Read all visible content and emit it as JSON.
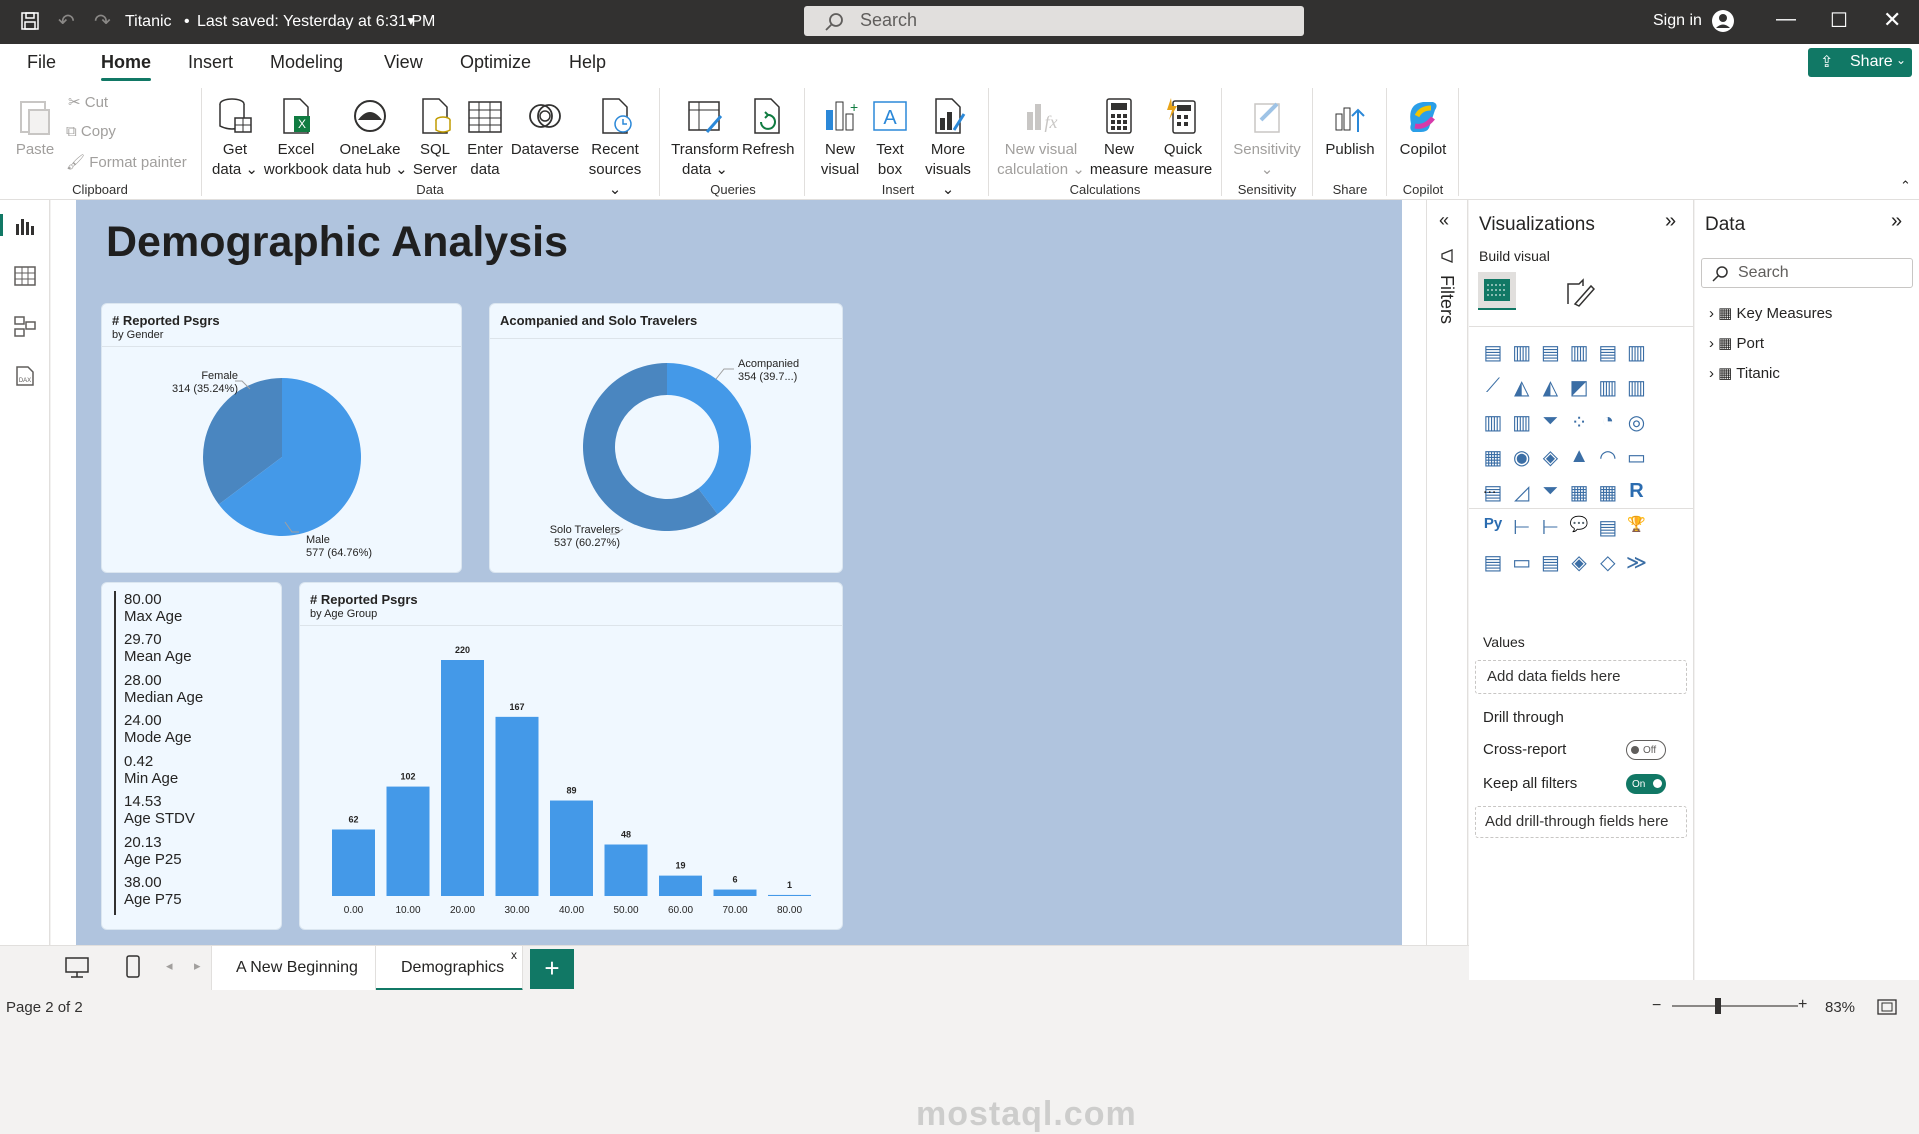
{
  "titlebar": {
    "file_name": "Titanic",
    "saved": "Last saved: Yesterday at 6:31 PM",
    "search_placeholder": "Search",
    "sign_in": "Sign in"
  },
  "menu": {
    "items": [
      "File",
      "Home",
      "Insert",
      "Modeling",
      "View",
      "Optimize",
      "Help"
    ],
    "active": "Home",
    "share": "Share"
  },
  "ribbon": {
    "clipboard": {
      "paste": "Paste",
      "cut": "Cut",
      "copy": "Copy",
      "format_painter": "Format painter",
      "group": "Clipboard"
    },
    "data": {
      "get_data": [
        "Get",
        "data"
      ],
      "excel": [
        "Excel",
        "workbook"
      ],
      "onelake": [
        "OneLake",
        "data hub"
      ],
      "sql": [
        "SQL",
        "Server"
      ],
      "enter": [
        "Enter",
        "data"
      ],
      "dataverse": "Dataverse",
      "recent": [
        "Recent",
        "sources"
      ],
      "group": "Data"
    },
    "queries": {
      "transform": [
        "Transform",
        "data"
      ],
      "refresh": "Refresh",
      "group": "Queries"
    },
    "insert": {
      "new_visual": [
        "New",
        "visual"
      ],
      "text_box": [
        "Text",
        "box"
      ],
      "more_visuals": [
        "More",
        "visuals"
      ],
      "group": "Insert"
    },
    "calculations": {
      "new_visual_calc": [
        "New visual",
        "calculation"
      ],
      "new_measure": [
        "New",
        "measure"
      ],
      "quick_measure": [
        "Quick",
        "measure"
      ],
      "group": "Calculations"
    },
    "sensitivity": {
      "label": "Sensitivity",
      "group": "Sensitivity"
    },
    "share": {
      "publish": "Publish",
      "group": "Share"
    },
    "copilot": {
      "label": "Copilot",
      "group": "Copilot"
    }
  },
  "report": {
    "title": "Demographic Analysis",
    "gender_card": {
      "title": "# Reported Psgrs",
      "subtitle": "by Gender",
      "female_label": "Female",
      "female_value": "314 (35.24%)",
      "male_label": "Male",
      "male_value": "577 (64.76%)"
    },
    "travel_card": {
      "title": "Acompanied and Solo Travelers",
      "acc_label": "Acompanied",
      "acc_value": "354 (39.7...)",
      "solo_label": "Solo Travelers",
      "solo_value": "537 (60.27%)"
    },
    "stats": [
      {
        "value": "80.00",
        "label": "Max Age"
      },
      {
        "value": "29.70",
        "label": "Mean Age"
      },
      {
        "value": "28.00",
        "label": "Median Age"
      },
      {
        "value": "24.00",
        "label": "Mode Age"
      },
      {
        "value": "0.42",
        "label": "Min Age"
      },
      {
        "value": "14.53",
        "label": "Age STDV"
      },
      {
        "value": "20.13",
        "label": "Age P25"
      },
      {
        "value": "38.00",
        "label": "Age P75"
      }
    ],
    "age_card": {
      "title": "# Reported Psgrs",
      "subtitle": "by Age Group"
    }
  },
  "chart_data": [
    {
      "type": "pie",
      "title": "# Reported Psgrs",
      "subtitle": "by Gender",
      "categories": [
        "Female",
        "Male"
      ],
      "values": [
        314,
        577
      ],
      "labels": [
        "314 (35.24%)",
        "577 (64.76%)"
      ],
      "colors": [
        "#4a86c0",
        "#4499e8"
      ]
    },
    {
      "type": "pie",
      "title": "Acompanied and Solo Travelers",
      "donut": true,
      "categories": [
        "Acompanied",
        "Solo Travelers"
      ],
      "values": [
        354,
        537
      ],
      "labels": [
        "354 (39.7...)",
        "537 (60.27%)"
      ],
      "colors": [
        "#4499e8",
        "#4a86c0"
      ]
    },
    {
      "type": "bar",
      "title": "# Reported Psgrs",
      "subtitle": "by Age Group",
      "categories": [
        "0.00",
        "10.00",
        "20.00",
        "30.00",
        "40.00",
        "50.00",
        "60.00",
        "70.00",
        "80.00"
      ],
      "values": [
        62,
        102,
        220,
        167,
        89,
        48,
        19,
        6,
        1
      ],
      "color": "#4499e8",
      "ylim": [
        0,
        220
      ]
    }
  ],
  "filters": {
    "label": "Filters"
  },
  "visualizations": {
    "title": "Visualizations",
    "build_visual": "Build visual",
    "values_label": "Values",
    "values_box": "Add data fields here",
    "drill_through": "Drill through",
    "cross_report": "Cross-report",
    "cross_report_state": "Off",
    "keep_filters": "Keep all filters",
    "keep_filters_state": "On",
    "drill_box": "Add drill-through fields here",
    "more": "..."
  },
  "data_pane": {
    "title": "Data",
    "search_placeholder": "Search",
    "items": [
      "Key Measures",
      "Port",
      "Titanic"
    ]
  },
  "tabs": {
    "pages": [
      "A New Beginning",
      "Demographics"
    ],
    "active": "Demographics",
    "close": "x",
    "add": "+"
  },
  "status": {
    "page": "Page 2 of 2",
    "zoom": "83%"
  },
  "watermark": "mostaql.com"
}
